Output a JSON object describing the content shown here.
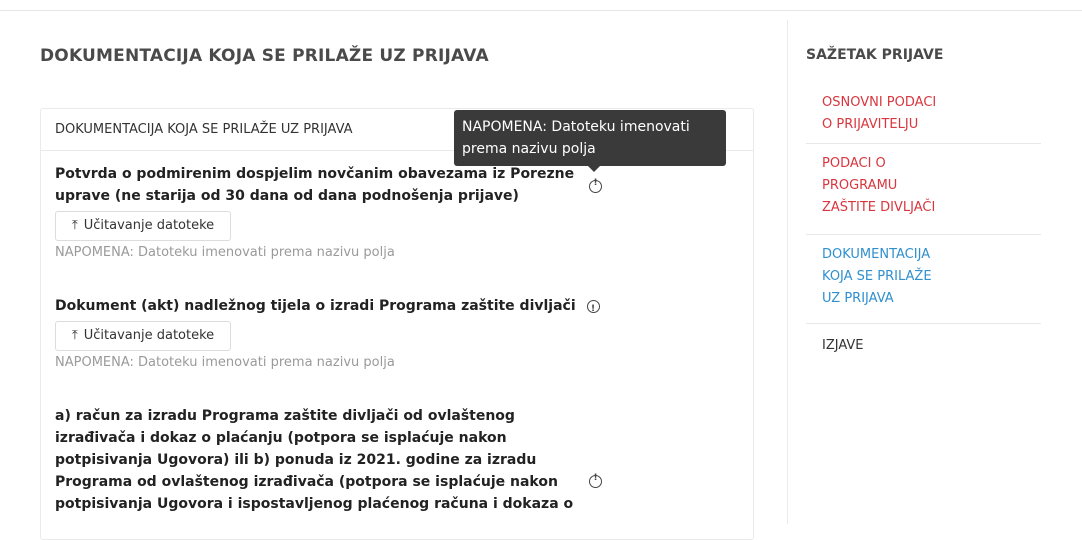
{
  "page_title": "DOKUMENTACIJA KOJA SE PRILAŽE UZ PRIJAVA",
  "card": {
    "header": "DOKUMENTACIJA KOJA SE PRILAŽE UZ PRIJAVA",
    "fields": [
      {
        "label_lines": [
          "Potvrda o podmirenim dospjelim novčanim obavezama iz Porezne",
          "uprave (ne starija od 30 dana od dana podnošenja prijave)"
        ],
        "upload_label": "Učitavanje datoteke",
        "note": "NAPOMENA: Datoteku imenovati prema nazivu polja"
      },
      {
        "label_lines": [
          "Dokument (akt) nadležnog tijela o izradi Programa zaštite divljači"
        ],
        "upload_label": "Učitavanje datoteke",
        "note": "NAPOMENA: Datoteku imenovati prema nazivu polja"
      },
      {
        "label_lines": [
          "a) račun za izradu Programa zaštite divljači od ovlaštenog",
          "izrađivača i dokaz o plaćanju (potpora se isplaćuje nakon",
          "potpisivanja Ugovora) ili b) ponuda iz 2021. godine za izradu",
          "Programa od ovlaštenog izrađivača (potpora se isplaćuje nakon",
          "potpisivanja Ugovora i ispostavljenog plaćenog računa i dokaza o"
        ]
      }
    ]
  },
  "tooltip": {
    "lines": [
      "NAPOMENA: Datoteku imenovati",
      "prema nazivu polja"
    ]
  },
  "summary": {
    "title": "SAŽETAK PRIJAVE",
    "items": [
      {
        "lines": [
          "OSNOVNI PODACI",
          "O PRIJAVITELJU"
        ],
        "color": "#d9363e"
      },
      {
        "lines": [
          "PODACI O",
          "PROGRAMU",
          "ZAŠTITE DIVLJAČI"
        ],
        "color": "#d9363e"
      },
      {
        "lines": [
          "DOKUMENTACIJA",
          "KOJA SE PRILAŽE",
          "UZ PRIJAVA"
        ],
        "color": "#2f8fcf"
      },
      {
        "lines": [
          "IZJAVE"
        ],
        "color": "#333333"
      }
    ]
  },
  "icons": {
    "upload": "upload-icon",
    "info": "info-icon"
  }
}
